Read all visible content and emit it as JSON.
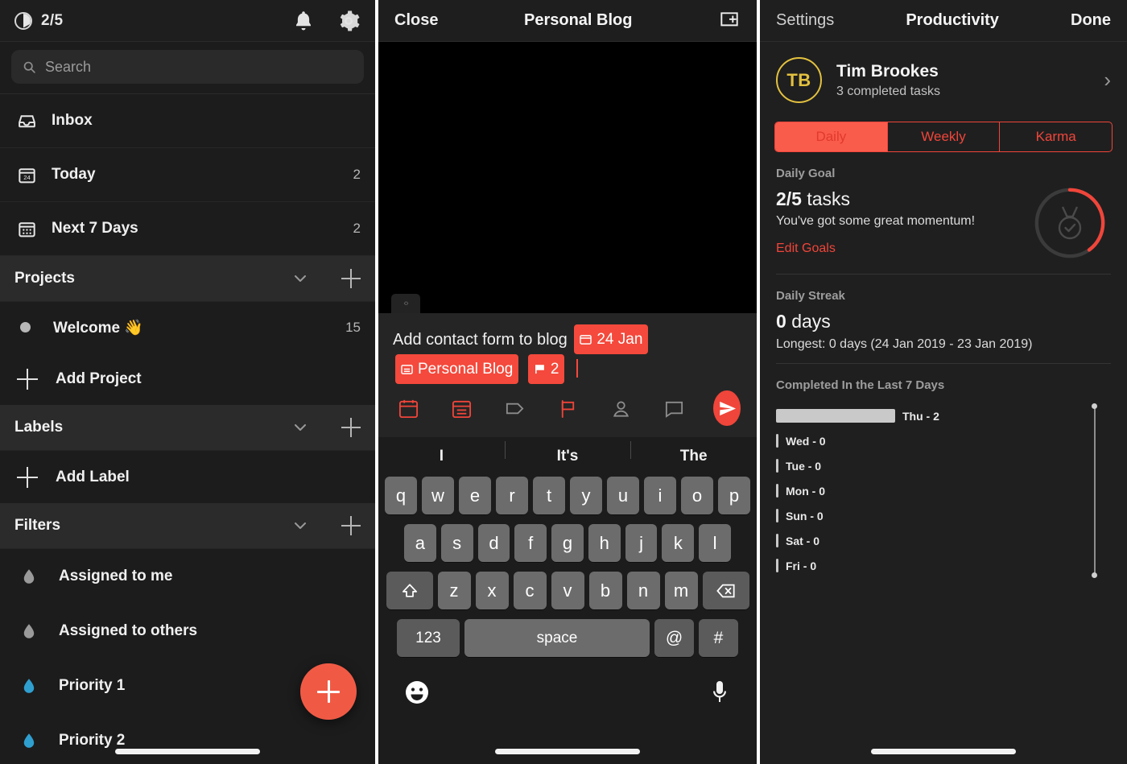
{
  "left_panel": {
    "statusbar": {
      "karma_icon": "pie-progress-icon",
      "karma_value": "2/5",
      "bell_icon": "bell-icon",
      "gear_icon": "gear-icon"
    },
    "search": {
      "placeholder": "Search",
      "icon": "search-icon"
    },
    "nav": [
      {
        "icon": "inbox-icon",
        "label": "Inbox",
        "count": ""
      },
      {
        "icon": "calendar-24-icon",
        "label": "Today",
        "count": "2"
      },
      {
        "icon": "calendar-dots-icon",
        "label": "Next 7 Days",
        "count": "2"
      }
    ],
    "projects_section": {
      "title": "Projects",
      "collapse_icon": "chevron-down-icon",
      "add_icon": "plus-icon",
      "items": [
        {
          "name": "Welcome 👋",
          "count": "15",
          "dot_color": "#b7b7b7"
        }
      ],
      "add_label": "Add Project"
    },
    "labels_section": {
      "title": "Labels",
      "collapse_icon": "chevron-down-icon",
      "add_icon": "plus-icon",
      "add_label": "Add Label"
    },
    "filters_section": {
      "title": "Filters",
      "collapse_icon": "chevron-down-icon",
      "add_icon": "plus-icon",
      "items": [
        {
          "name": "Assigned to me",
          "color": "#9a9a9a"
        },
        {
          "name": "Assigned to others",
          "color": "#9a9a9a"
        },
        {
          "name": "Priority 1",
          "color": "#2f9fd0"
        },
        {
          "name": "Priority 2",
          "color": "#2f9fd0"
        }
      ]
    },
    "fab": {
      "icon": "plus-icon",
      "color": "#f05a45"
    }
  },
  "mid_panel": {
    "topbar": {
      "close_label": "Close",
      "title": "Personal Blog",
      "add_icon": "add-to-view-icon"
    },
    "drag_tab": {
      "glyph": "‹›"
    },
    "compose": {
      "text": "Add contact form to blog",
      "chips": [
        {
          "icon": "calendar-icon",
          "label": "24 Jan"
        },
        {
          "icon": "project-icon",
          "label": "Personal Blog"
        },
        {
          "icon": "flag-icon",
          "label": "2"
        }
      ],
      "tools": [
        {
          "icon": "calendar-icon",
          "active": true
        },
        {
          "icon": "project-icon",
          "active": true
        },
        {
          "icon": "label-tag-icon",
          "active": false
        },
        {
          "icon": "flag-icon",
          "active": true
        },
        {
          "icon": "assignee-icon",
          "active": false
        },
        {
          "icon": "comment-icon",
          "active": false
        }
      ],
      "send_icon": "send-icon",
      "accent": "#f0453a"
    },
    "keyboard": {
      "predictions": [
        "I",
        "It's",
        "The"
      ],
      "row1": [
        "q",
        "w",
        "e",
        "r",
        "t",
        "y",
        "u",
        "i",
        "o",
        "p"
      ],
      "row2": [
        "a",
        "s",
        "d",
        "f",
        "g",
        "h",
        "j",
        "k",
        "l"
      ],
      "row3": [
        "z",
        "x",
        "c",
        "v",
        "b",
        "n",
        "m"
      ],
      "shift_icon": "shift-icon",
      "backspace_icon": "backspace-icon",
      "numbers_label": "123",
      "space_label": "space",
      "at_label": "@",
      "hash_label": "#",
      "emoji_icon": "emoji-icon",
      "mic_icon": "microphone-icon"
    }
  },
  "right_panel": {
    "topbar": {
      "back_label": "Settings",
      "title": "Productivity",
      "done_label": "Done"
    },
    "profile": {
      "initials": "TB",
      "name": "Tim Brookes",
      "subtitle": "3 completed tasks",
      "chevron": "›",
      "ring_color": "#e3c13f"
    },
    "segments": [
      {
        "label": "Daily",
        "selected": true
      },
      {
        "label": "Weekly",
        "selected": false
      },
      {
        "label": "Karma",
        "selected": false
      }
    ],
    "daily_goal": {
      "section_label": "Daily Goal",
      "value": "2/5",
      "unit": "tasks",
      "message": "You've got some great momentum!",
      "edit_link": "Edit Goals",
      "ring_icon": "medal-check-icon",
      "ring_percent": 40,
      "ring_color": "#f0453a"
    },
    "daily_streak": {
      "section_label": "Daily Streak",
      "value": "0",
      "unit": "days",
      "longest": "Longest: 0 days (24 Jan 2019 - 23 Jan 2019)"
    },
    "chart_data": {
      "type": "bar",
      "title": "Completed In the Last 7 Days",
      "orientation": "horizontal",
      "categories": [
        "Thu",
        "Wed",
        "Tue",
        "Mon",
        "Sun",
        "Sat",
        "Fri"
      ],
      "values": [
        2,
        0,
        0,
        0,
        0,
        0,
        0
      ],
      "labels": [
        "Thu - 2",
        "Wed - 0",
        "Tue - 0",
        "Mon - 0",
        "Sun - 0",
        "Sat - 0",
        "Fri - 0"
      ],
      "xlabel": "",
      "ylabel": "",
      "xlim": [
        0,
        2
      ],
      "grid": false,
      "legend": false,
      "bar_color": "#c9c9c9"
    }
  }
}
